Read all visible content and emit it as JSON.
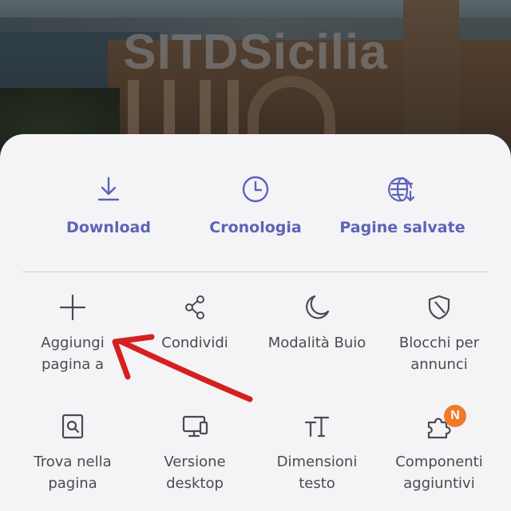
{
  "background": {
    "site_title": "SITDSicilia"
  },
  "sheet": {
    "top_actions": [
      {
        "label": "Download",
        "icon": "download-icon"
      },
      {
        "label": "Cronologia",
        "icon": "clock-icon"
      },
      {
        "label": "Pagine salvate",
        "icon": "saved-pages-globe-icon"
      }
    ],
    "grid": [
      {
        "label": "Aggiungi\npagina a",
        "icon": "plus-icon"
      },
      {
        "label": "Condividi",
        "icon": "share-icon"
      },
      {
        "label": "Modalità Buio",
        "icon": "moon-icon"
      },
      {
        "label": "Blocchi per\nannunci",
        "icon": "shield-icon"
      },
      {
        "label": "Trova nella\npagina",
        "icon": "find-in-page-icon"
      },
      {
        "label": "Versione\ndesktop",
        "icon": "desktop-icon"
      },
      {
        "label": "Dimensioni\ntesto",
        "icon": "text-size-icon"
      },
      {
        "label": "Componenti\naggiuntivi",
        "icon": "puzzle-icon",
        "badge": "N"
      }
    ]
  },
  "colors": {
    "accent": "#5d63b8",
    "badge": "#f07a2a",
    "annotation_arrow": "#d62020"
  }
}
